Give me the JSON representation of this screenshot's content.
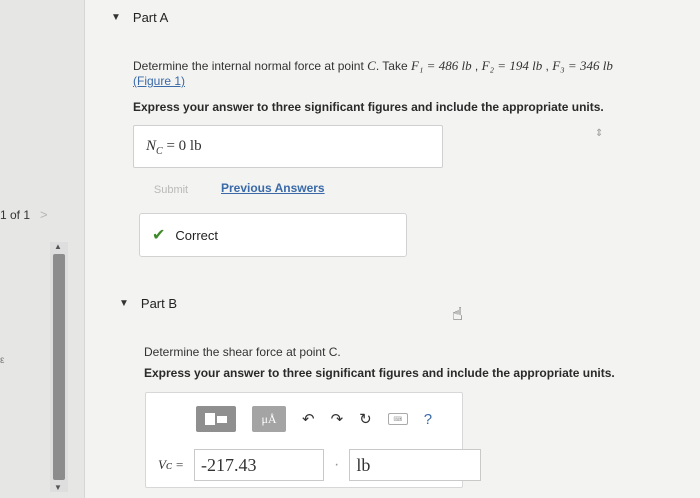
{
  "sidebar": {
    "pager_text": "1 of 1",
    "pager_next": ">"
  },
  "part_a": {
    "title": "Part A",
    "question_prefix": "Determine the internal normal force at point",
    "point": "C",
    "question_take": ". Take",
    "f1": "F₁ = 486 lb",
    "f2": "F₂ = 194 lb",
    "f3": "F₃ = 346 lb",
    "figure_link": "(Figure 1)",
    "instruction": "Express your answer to three significant figures and include the appropriate units.",
    "answer_var": "N",
    "answer_sub": "C",
    "answer_value": " = 0 lb",
    "submit_label": "Submit",
    "previous_answers_label": "Previous Answers",
    "status_label": "Correct"
  },
  "part_b": {
    "title": "Part B",
    "question": "Determine the shear force at point C.",
    "instruction": "Express your answer to three significant figures and include the appropriate units.",
    "var_label": "Vᴄ =",
    "value": "-217.43",
    "unit": "lb",
    "units_button": "μÅ",
    "help_label": "?"
  }
}
